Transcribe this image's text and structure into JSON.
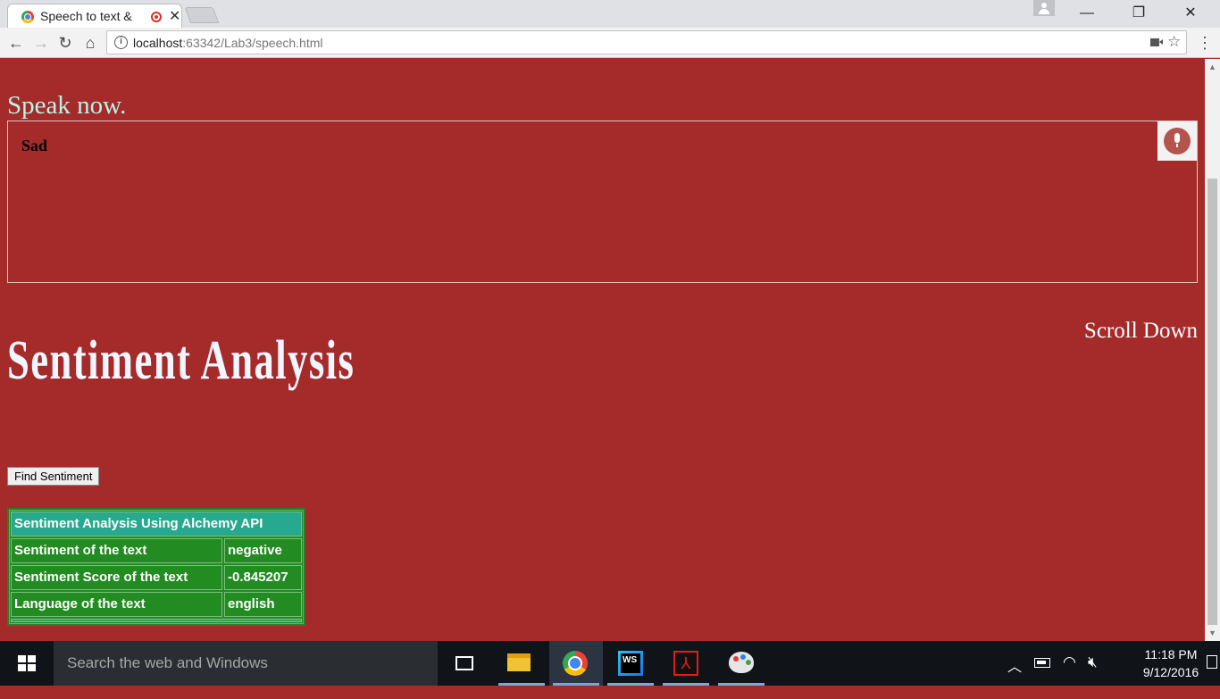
{
  "browser": {
    "tab_title": "Speech to text &",
    "url_host": "localhost",
    "url_rest": ":63342/Lab3/speech.html"
  },
  "page": {
    "prompt": "Speak now.",
    "speech_text": "Sad",
    "scroll_hint": "Scroll Down",
    "heading": "Sentiment Analysis",
    "find_button": "Find Sentiment",
    "table": {
      "header": "Sentiment Analysis Using Alchemy API",
      "rows": [
        {
          "label": "Sentiment of the text",
          "value": "negative"
        },
        {
          "label": "Sentiment Score of the text",
          "value": "-0.845207"
        },
        {
          "label": "Language of the text",
          "value": "english"
        }
      ]
    }
  },
  "taskbar": {
    "search_placeholder": "Search the web and Windows",
    "time": "11:18 PM",
    "date": "9/12/2016"
  }
}
